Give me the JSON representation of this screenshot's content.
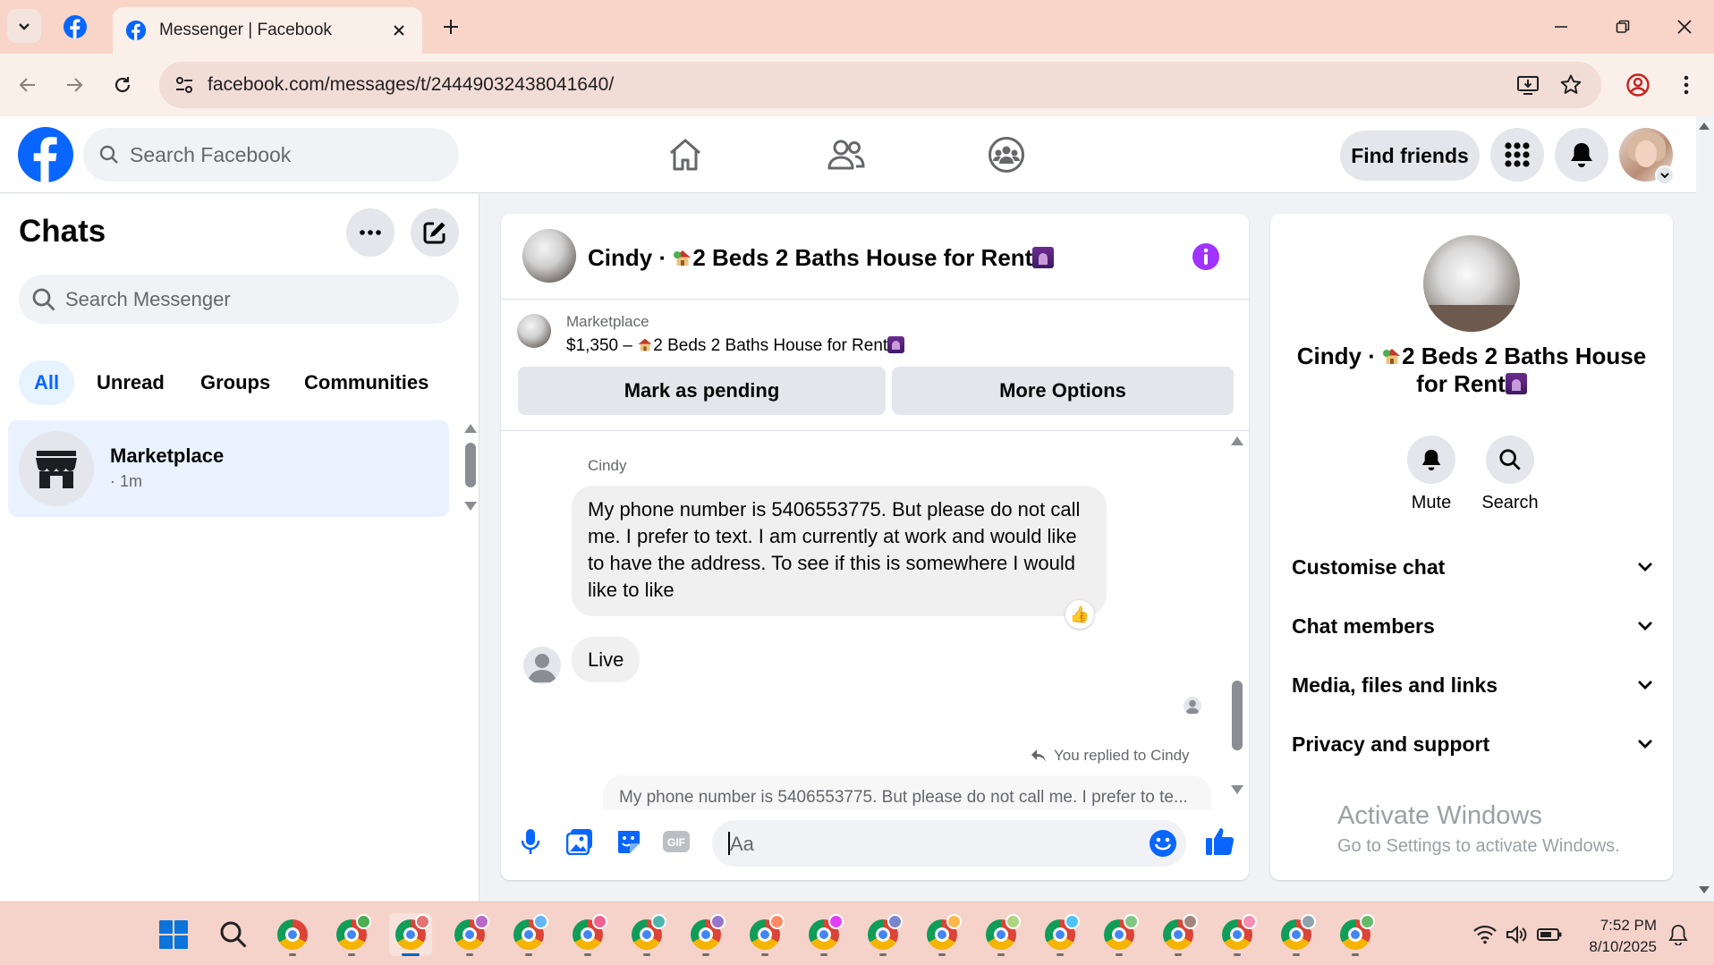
{
  "browser": {
    "tab_title": "Messenger | Facebook",
    "url": "facebook.com/messages/t/24449032438041640/"
  },
  "header": {
    "search_placeholder": "Search Facebook",
    "find_friends": "Find friends"
  },
  "chats": {
    "title": "Chats",
    "search_placeholder": "Search Messenger",
    "filters": [
      "All",
      "Unread",
      "Groups",
      "Communities"
    ],
    "active_filter": "All",
    "items": [
      {
        "name": "Marketplace",
        "time": "· 1m"
      }
    ]
  },
  "conversation": {
    "title_prefix": "Cindy · ",
    "title_main": "2 Beds 2 Baths House for Rent",
    "marketplace_label": "Marketplace",
    "listing_prefix": "$1,350 – ",
    "listing_title": "2 Beds 2 Baths House for Rent",
    "buttons": {
      "pending": "Mark as pending",
      "more": "More Options"
    },
    "messages": {
      "sender": "Cindy",
      "long_text": "My phone number is 5406553775. But please do not call me. I prefer to text.  I am currently at work and would like to have the address. To see if this is somewhere I would like to like",
      "reaction": "👍",
      "short_text": "Live",
      "replied_note": "You replied to Cindy",
      "quoted_text": "My phone number is 5406553775. But please do not call me. I prefer to te..."
    },
    "composer_placeholder": "Aa"
  },
  "details": {
    "name_line1": "Cindy · ",
    "name_line1b": "2 Beds 2 Baths House",
    "name_line2": "for Rent",
    "actions": {
      "mute": "Mute",
      "search": "Search"
    },
    "sections": [
      "Customise chat",
      "Chat members",
      "Media, files and links",
      "Privacy and support"
    ]
  },
  "watermark": {
    "title": "Activate Windows",
    "subtitle": "Go to Settings to activate Windows."
  },
  "taskbar": {
    "time": "7:52 PM",
    "date": "8/10/2025"
  },
  "colors": {
    "facebook_blue": "#0866ff",
    "messenger_purple": "#a033ff",
    "tabbar_bg": "#f9d5c9",
    "taskbar_bg": "#f5d3ca"
  }
}
